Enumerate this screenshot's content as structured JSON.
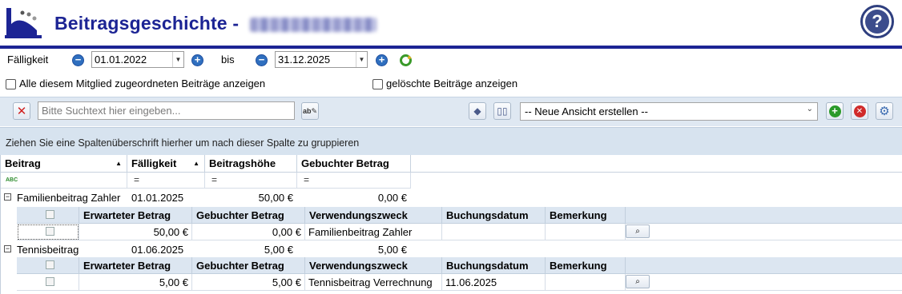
{
  "header": {
    "title": "Beitragsgeschichte - ",
    "help_label": "?"
  },
  "filter": {
    "faelligkeit_label": "Fälligkeit",
    "from_date": "01.01.2022",
    "bis_label": "bis",
    "to_date": "31.12.2025",
    "show_all_label": "Alle diesem Mitglied zugeordneten Beiträge anzeigen",
    "show_deleted_label": "gelöschte Beiträge anzeigen"
  },
  "toolbar": {
    "search_placeholder": "Bitte Suchtext hier eingeben...",
    "view_select_value": "-- Neue Ansicht erstellen --"
  },
  "grid": {
    "group_hint": "Ziehen Sie eine Spaltenüberschrift hierher um nach dieser Spalte zu gruppieren",
    "columns": [
      "Beitrag",
      "Fälligkeit",
      "Beitragshöhe",
      "Gebuchter Betrag"
    ],
    "filter_icon_label": "ABC",
    "filter_eq": "=",
    "groups": [
      {
        "beitrag": "Familienbeitrag Zahler",
        "faelligkeit": "01.01.2025",
        "beitragshoehe": "50,00 €",
        "gebucht": "0,00 €",
        "sub_columns": [
          "Erwarteter Betrag",
          "Gebuchter Betrag",
          "Verwendungszweck",
          "Buchungsdatum",
          "Bemerkung"
        ],
        "rows": [
          {
            "erwartet": "50,00 €",
            "gebucht": "0,00 €",
            "zweck": "Familienbeitrag Zahler",
            "datum": "",
            "bemerkung": ""
          }
        ]
      },
      {
        "beitrag": "Tennisbeitrag",
        "faelligkeit": "01.06.2025",
        "beitragshoehe": "5,00 €",
        "gebucht": "5,00 €",
        "sub_columns": [
          "Erwarteter Betrag",
          "Gebuchter Betrag",
          "Verwendungszweck",
          "Buchungsdatum",
          "Bemerkung"
        ],
        "rows": [
          {
            "erwartet": "5,00 €",
            "gebucht": "5,00 €",
            "zweck": "Tennisbeitrag Verrechnung",
            "datum": "11.06.2025",
            "bemerkung": ""
          }
        ]
      }
    ]
  },
  "colors": {
    "brand": "#1c2494",
    "toolbar_bg": "#dfe8f2",
    "subheader_bg": "#dce6f1"
  }
}
